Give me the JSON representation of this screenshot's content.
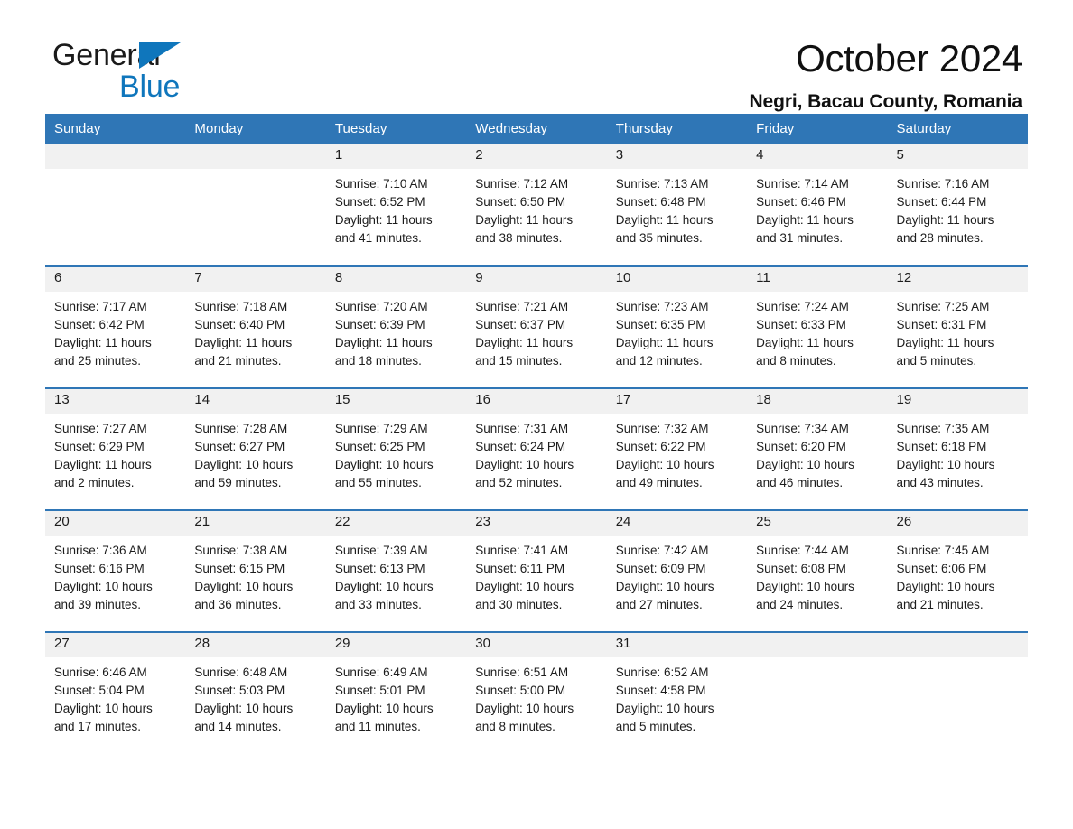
{
  "brand": {
    "name_part1": "General",
    "name_part2": "Blue",
    "accent_color": "#0f76bc",
    "triangle_icon": "triangle-icon"
  },
  "header": {
    "title": "October 2024",
    "subtitle": "Negri, Bacau County, Romania",
    "header_bg_color": "#2f76b6",
    "row_divider_color": "#2f76b6",
    "daynum_band_color": "#f1f1f1"
  },
  "weekday_headers": [
    "Sunday",
    "Monday",
    "Tuesday",
    "Wednesday",
    "Thursday",
    "Friday",
    "Saturday"
  ],
  "calendar": {
    "month": "October",
    "year": "2024",
    "weeks": [
      [
        {
          "day": "",
          "empty": true
        },
        {
          "day": "",
          "empty": true
        },
        {
          "day": "1",
          "sunrise": "Sunrise: 7:10 AM",
          "sunset": "Sunset: 6:52 PM",
          "daylight_line1": "Daylight: 11 hours",
          "daylight_line2": "and 41 minutes."
        },
        {
          "day": "2",
          "sunrise": "Sunrise: 7:12 AM",
          "sunset": "Sunset: 6:50 PM",
          "daylight_line1": "Daylight: 11 hours",
          "daylight_line2": "and 38 minutes."
        },
        {
          "day": "3",
          "sunrise": "Sunrise: 7:13 AM",
          "sunset": "Sunset: 6:48 PM",
          "daylight_line1": "Daylight: 11 hours",
          "daylight_line2": "and 35 minutes."
        },
        {
          "day": "4",
          "sunrise": "Sunrise: 7:14 AM",
          "sunset": "Sunset: 6:46 PM",
          "daylight_line1": "Daylight: 11 hours",
          "daylight_line2": "and 31 minutes."
        },
        {
          "day": "5",
          "sunrise": "Sunrise: 7:16 AM",
          "sunset": "Sunset: 6:44 PM",
          "daylight_line1": "Daylight: 11 hours",
          "daylight_line2": "and 28 minutes."
        }
      ],
      [
        {
          "day": "6",
          "sunrise": "Sunrise: 7:17 AM",
          "sunset": "Sunset: 6:42 PM",
          "daylight_line1": "Daylight: 11 hours",
          "daylight_line2": "and 25 minutes."
        },
        {
          "day": "7",
          "sunrise": "Sunrise: 7:18 AM",
          "sunset": "Sunset: 6:40 PM",
          "daylight_line1": "Daylight: 11 hours",
          "daylight_line2": "and 21 minutes."
        },
        {
          "day": "8",
          "sunrise": "Sunrise: 7:20 AM",
          "sunset": "Sunset: 6:39 PM",
          "daylight_line1": "Daylight: 11 hours",
          "daylight_line2": "and 18 minutes."
        },
        {
          "day": "9",
          "sunrise": "Sunrise: 7:21 AM",
          "sunset": "Sunset: 6:37 PM",
          "daylight_line1": "Daylight: 11 hours",
          "daylight_line2": "and 15 minutes."
        },
        {
          "day": "10",
          "sunrise": "Sunrise: 7:23 AM",
          "sunset": "Sunset: 6:35 PM",
          "daylight_line1": "Daylight: 11 hours",
          "daylight_line2": "and 12 minutes."
        },
        {
          "day": "11",
          "sunrise": "Sunrise: 7:24 AM",
          "sunset": "Sunset: 6:33 PM",
          "daylight_line1": "Daylight: 11 hours",
          "daylight_line2": "and 8 minutes."
        },
        {
          "day": "12",
          "sunrise": "Sunrise: 7:25 AM",
          "sunset": "Sunset: 6:31 PM",
          "daylight_line1": "Daylight: 11 hours",
          "daylight_line2": "and 5 minutes."
        }
      ],
      [
        {
          "day": "13",
          "sunrise": "Sunrise: 7:27 AM",
          "sunset": "Sunset: 6:29 PM",
          "daylight_line1": "Daylight: 11 hours",
          "daylight_line2": "and 2 minutes."
        },
        {
          "day": "14",
          "sunrise": "Sunrise: 7:28 AM",
          "sunset": "Sunset: 6:27 PM",
          "daylight_line1": "Daylight: 10 hours",
          "daylight_line2": "and 59 minutes."
        },
        {
          "day": "15",
          "sunrise": "Sunrise: 7:29 AM",
          "sunset": "Sunset: 6:25 PM",
          "daylight_line1": "Daylight: 10 hours",
          "daylight_line2": "and 55 minutes."
        },
        {
          "day": "16",
          "sunrise": "Sunrise: 7:31 AM",
          "sunset": "Sunset: 6:24 PM",
          "daylight_line1": "Daylight: 10 hours",
          "daylight_line2": "and 52 minutes."
        },
        {
          "day": "17",
          "sunrise": "Sunrise: 7:32 AM",
          "sunset": "Sunset: 6:22 PM",
          "daylight_line1": "Daylight: 10 hours",
          "daylight_line2": "and 49 minutes."
        },
        {
          "day": "18",
          "sunrise": "Sunrise: 7:34 AM",
          "sunset": "Sunset: 6:20 PM",
          "daylight_line1": "Daylight: 10 hours",
          "daylight_line2": "and 46 minutes."
        },
        {
          "day": "19",
          "sunrise": "Sunrise: 7:35 AM",
          "sunset": "Sunset: 6:18 PM",
          "daylight_line1": "Daylight: 10 hours",
          "daylight_line2": "and 43 minutes."
        }
      ],
      [
        {
          "day": "20",
          "sunrise": "Sunrise: 7:36 AM",
          "sunset": "Sunset: 6:16 PM",
          "daylight_line1": "Daylight: 10 hours",
          "daylight_line2": "and 39 minutes."
        },
        {
          "day": "21",
          "sunrise": "Sunrise: 7:38 AM",
          "sunset": "Sunset: 6:15 PM",
          "daylight_line1": "Daylight: 10 hours",
          "daylight_line2": "and 36 minutes."
        },
        {
          "day": "22",
          "sunrise": "Sunrise: 7:39 AM",
          "sunset": "Sunset: 6:13 PM",
          "daylight_line1": "Daylight: 10 hours",
          "daylight_line2": "and 33 minutes."
        },
        {
          "day": "23",
          "sunrise": "Sunrise: 7:41 AM",
          "sunset": "Sunset: 6:11 PM",
          "daylight_line1": "Daylight: 10 hours",
          "daylight_line2": "and 30 minutes."
        },
        {
          "day": "24",
          "sunrise": "Sunrise: 7:42 AM",
          "sunset": "Sunset: 6:09 PM",
          "daylight_line1": "Daylight: 10 hours",
          "daylight_line2": "and 27 minutes."
        },
        {
          "day": "25",
          "sunrise": "Sunrise: 7:44 AM",
          "sunset": "Sunset: 6:08 PM",
          "daylight_line1": "Daylight: 10 hours",
          "daylight_line2": "and 24 minutes."
        },
        {
          "day": "26",
          "sunrise": "Sunrise: 7:45 AM",
          "sunset": "Sunset: 6:06 PM",
          "daylight_line1": "Daylight: 10 hours",
          "daylight_line2": "and 21 minutes."
        }
      ],
      [
        {
          "day": "27",
          "sunrise": "Sunrise: 6:46 AM",
          "sunset": "Sunset: 5:04 PM",
          "daylight_line1": "Daylight: 10 hours",
          "daylight_line2": "and 17 minutes."
        },
        {
          "day": "28",
          "sunrise": "Sunrise: 6:48 AM",
          "sunset": "Sunset: 5:03 PM",
          "daylight_line1": "Daylight: 10 hours",
          "daylight_line2": "and 14 minutes."
        },
        {
          "day": "29",
          "sunrise": "Sunrise: 6:49 AM",
          "sunset": "Sunset: 5:01 PM",
          "daylight_line1": "Daylight: 10 hours",
          "daylight_line2": "and 11 minutes."
        },
        {
          "day": "30",
          "sunrise": "Sunrise: 6:51 AM",
          "sunset": "Sunset: 5:00 PM",
          "daylight_line1": "Daylight: 10 hours",
          "daylight_line2": "and 8 minutes."
        },
        {
          "day": "31",
          "sunrise": "Sunrise: 6:52 AM",
          "sunset": "Sunset: 4:58 PM",
          "daylight_line1": "Daylight: 10 hours",
          "daylight_line2": "and 5 minutes."
        },
        {
          "day": "",
          "empty": true
        },
        {
          "day": "",
          "empty": true
        }
      ]
    ]
  }
}
